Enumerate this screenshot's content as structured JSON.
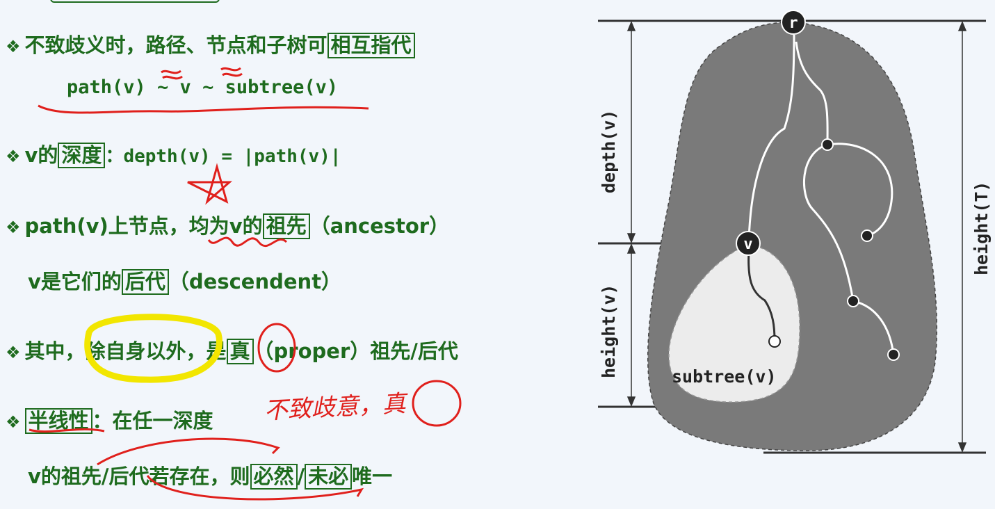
{
  "bullet_symbol": "❖",
  "lines": {
    "l1": {
      "text": "不致歧义时，路径、节点和子树可",
      "boxed": "相互指代"
    },
    "l2": {
      "text": "path(v) ~ v ~ subtree(v)"
    },
    "l3": {
      "pre": "v的",
      "boxed": "深度",
      "post": "：depth(v) = |path(v)|"
    },
    "l4": {
      "pre": "path(v)上节点，均为v的",
      "boxed": "祖先",
      "post": "（ancestor）"
    },
    "l5": {
      "pre": "v是它们的",
      "boxed": "后代",
      "post": "（descendent）"
    },
    "l6": {
      "pre": "其中，除自身以外，是",
      "boxed": "真",
      "post": "（proper）祖先/后代"
    },
    "l7": {
      "boxed": "半线性",
      "post": "：在任一深度"
    },
    "l8": {
      "pre": "v的祖先/后代若存在，则",
      "boxed1": "必然",
      "mid": "/",
      "boxed2": "未必",
      "post": "唯一"
    }
  },
  "handwriting": {
    "note": "不致歧意，真"
  },
  "diagram": {
    "root_label": "r",
    "node_label": "v",
    "subtree_label": "subtree(v)",
    "depth_label": "depth(v)",
    "height_v_label": "height(v)",
    "height_t_label": "height(T)"
  },
  "colors": {
    "text_green": "#1e6b1e",
    "tree_fill": "#7a7a7a",
    "subtree_fill": "#ececec",
    "annotation_red": "#e0201c",
    "highlight_yellow": "#f2e600"
  }
}
